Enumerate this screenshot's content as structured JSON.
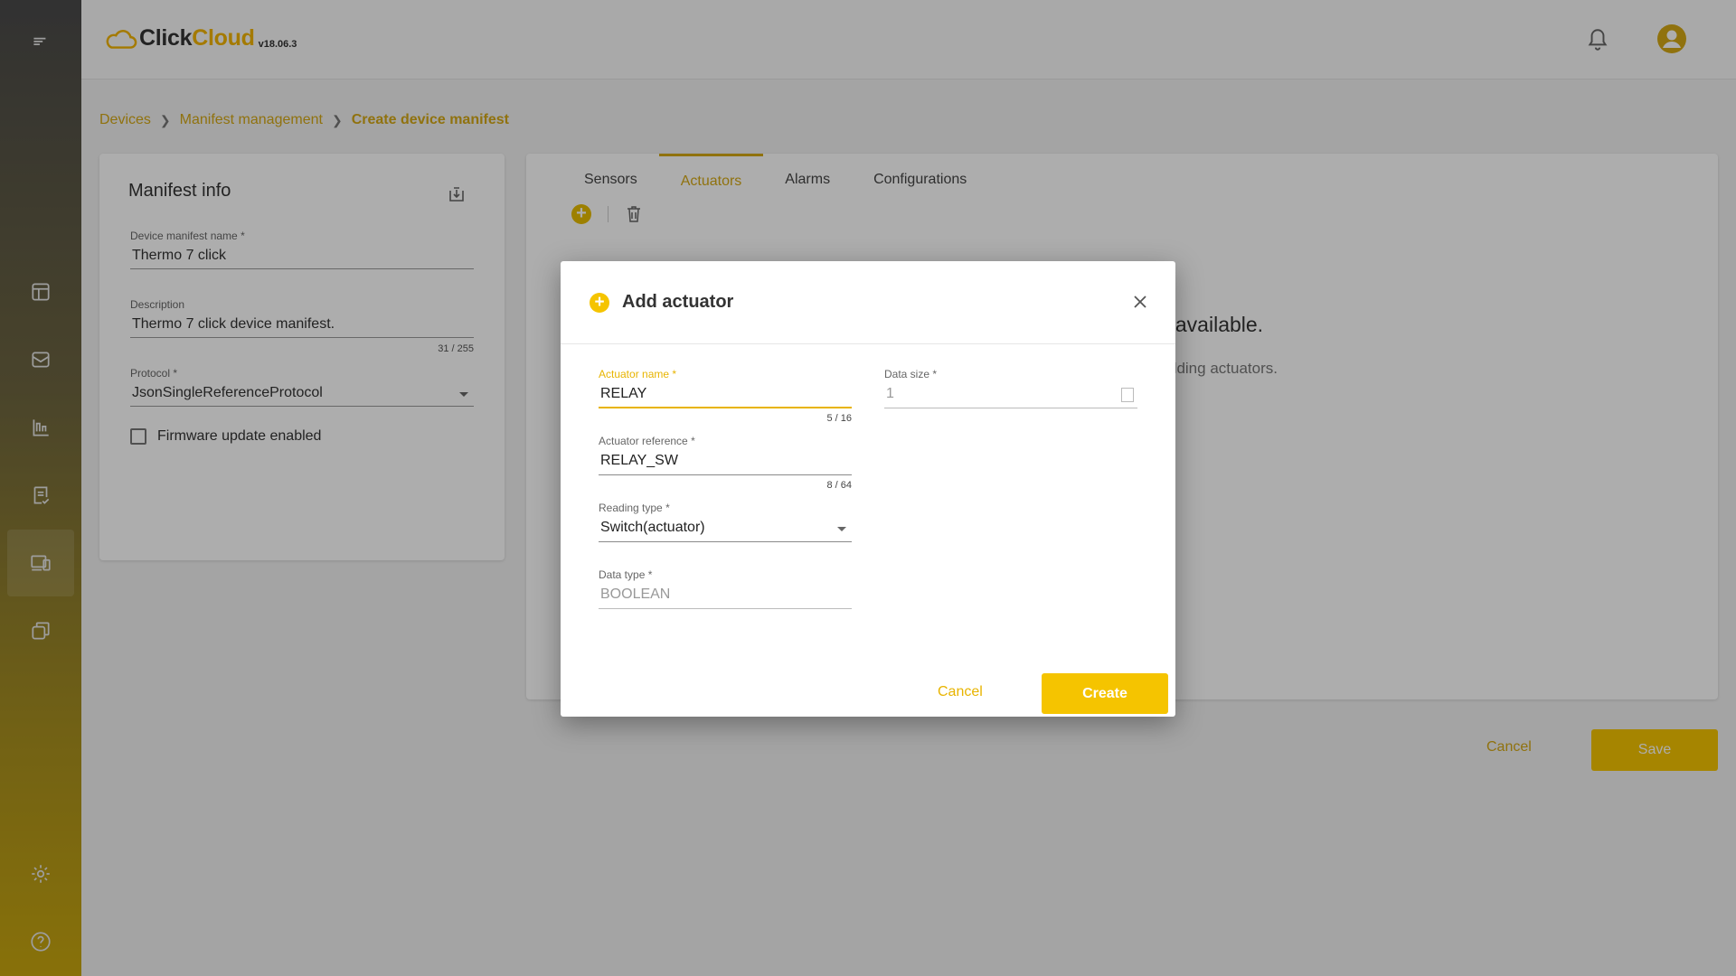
{
  "header": {
    "logo_prefix": "Click",
    "logo_suffix": "Cloud",
    "version": "v18.06.3"
  },
  "breadcrumb": {
    "items": [
      "Devices",
      "Manifest management"
    ],
    "current": "Create device manifest"
  },
  "manifest_info": {
    "title": "Manifest info",
    "name_label": "Device manifest name",
    "name_value": "Thermo 7 click",
    "description_label": "Description",
    "description_value": "Thermo 7 click device manifest.",
    "description_count": "31 / 255",
    "protocol_label": "Protocol",
    "protocol_value": "JsonSingleReferenceProtocol",
    "firmware_label": "Firmware update enabled",
    "required_marker": "*"
  },
  "tabs": {
    "sensors": "Sensors",
    "actuators": "Actuators",
    "alarms": "Alarms",
    "configurations": "Configurations"
  },
  "empty_state": {
    "title": "s available.",
    "subtitle": "dding actuators."
  },
  "footer": {
    "cancel_label": "Cancel",
    "save_label": "Save"
  },
  "dialog": {
    "title": "Add actuator",
    "actuator_name_label": "Actuator name",
    "actuator_name_value": "RELAY",
    "actuator_name_count": "5 / 16",
    "actuator_ref_label": "Actuator reference",
    "actuator_ref_value": "RELAY_SW",
    "actuator_ref_count": "8 / 64",
    "reading_type_label": "Reading type",
    "reading_type_value": "Switch(actuator)",
    "data_type_label": "Data type",
    "data_type_value": "BOOLEAN",
    "data_size_label": "Data size",
    "data_size_value": "1",
    "cancel_label": "Cancel",
    "create_label": "Create"
  },
  "colors": {
    "accent": "#f5c400",
    "link": "#d4a816"
  }
}
